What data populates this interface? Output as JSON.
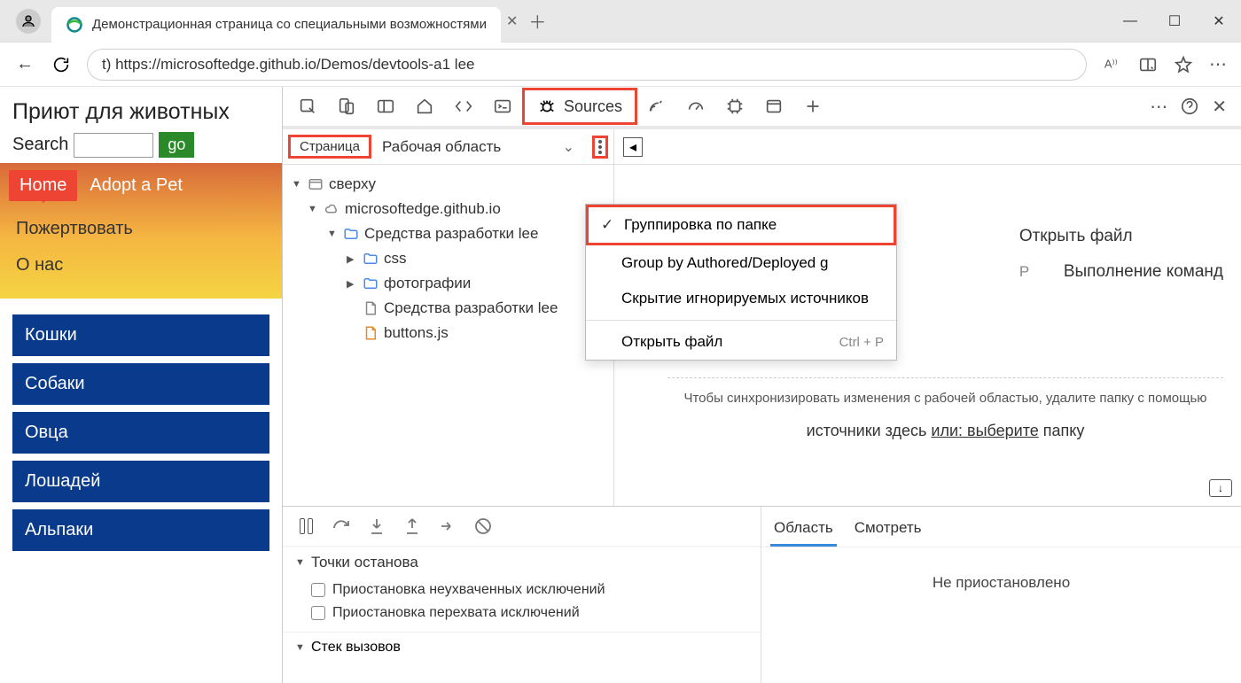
{
  "window": {
    "tab_title": "Демонстрационная страница со специальными возможностями",
    "url": "t) https://microsoftedge.github.io/Demos/devtools-a1 lee"
  },
  "page": {
    "title": "Приют для животных",
    "search_label": "Search",
    "go": "go",
    "nav": {
      "home": "Home",
      "adopt": "Adopt a Pet",
      "donate": "Пожертвовать",
      "about": "О нас"
    },
    "animals": [
      "Кошки",
      "Собаки",
      "Овца",
      "Лошадей",
      "Альпаки"
    ]
  },
  "devtools": {
    "sources_label": "Sources",
    "left_header": {
      "page_tab": "Страница",
      "workspace": "Рабочая область"
    },
    "tree": {
      "top": "сверху",
      "domain": "microsoftedge.github.io",
      "folder1": "Средства разработки lee",
      "css": "css",
      "photos": "фотографии",
      "file1": "Средства разработки lee",
      "file2": "buttons.js"
    },
    "context_menu": {
      "group_folder": "Группировка по папке",
      "group_authored": "Group by Authored/Deployed g",
      "hide_ignored": "Скрытие игнорируемых источников",
      "open_file": "Открыть файл",
      "open_file_shortcut": "Ctrl + P"
    },
    "hints": {
      "open_file": "Открыть файл",
      "run_commands": "Выполнение команд",
      "key_p": "P"
    },
    "sync": {
      "msg1": "Чтобы синхронизировать изменения с рабочей областью, удалите папку с помощью",
      "msg2_pre": "источники здесь ",
      "msg2_link": "или: выберите",
      "msg2_post": " папку"
    },
    "breakpoints": {
      "header": "Точки останова",
      "uncaught": "Приостановка неухваченных исключений",
      "caught": "Приостановка перехвата исключений"
    },
    "callstack": "Стек вызовов",
    "scope": {
      "scope": "Область",
      "watch": "Смотреть"
    },
    "not_paused": "Не приостановлено"
  }
}
